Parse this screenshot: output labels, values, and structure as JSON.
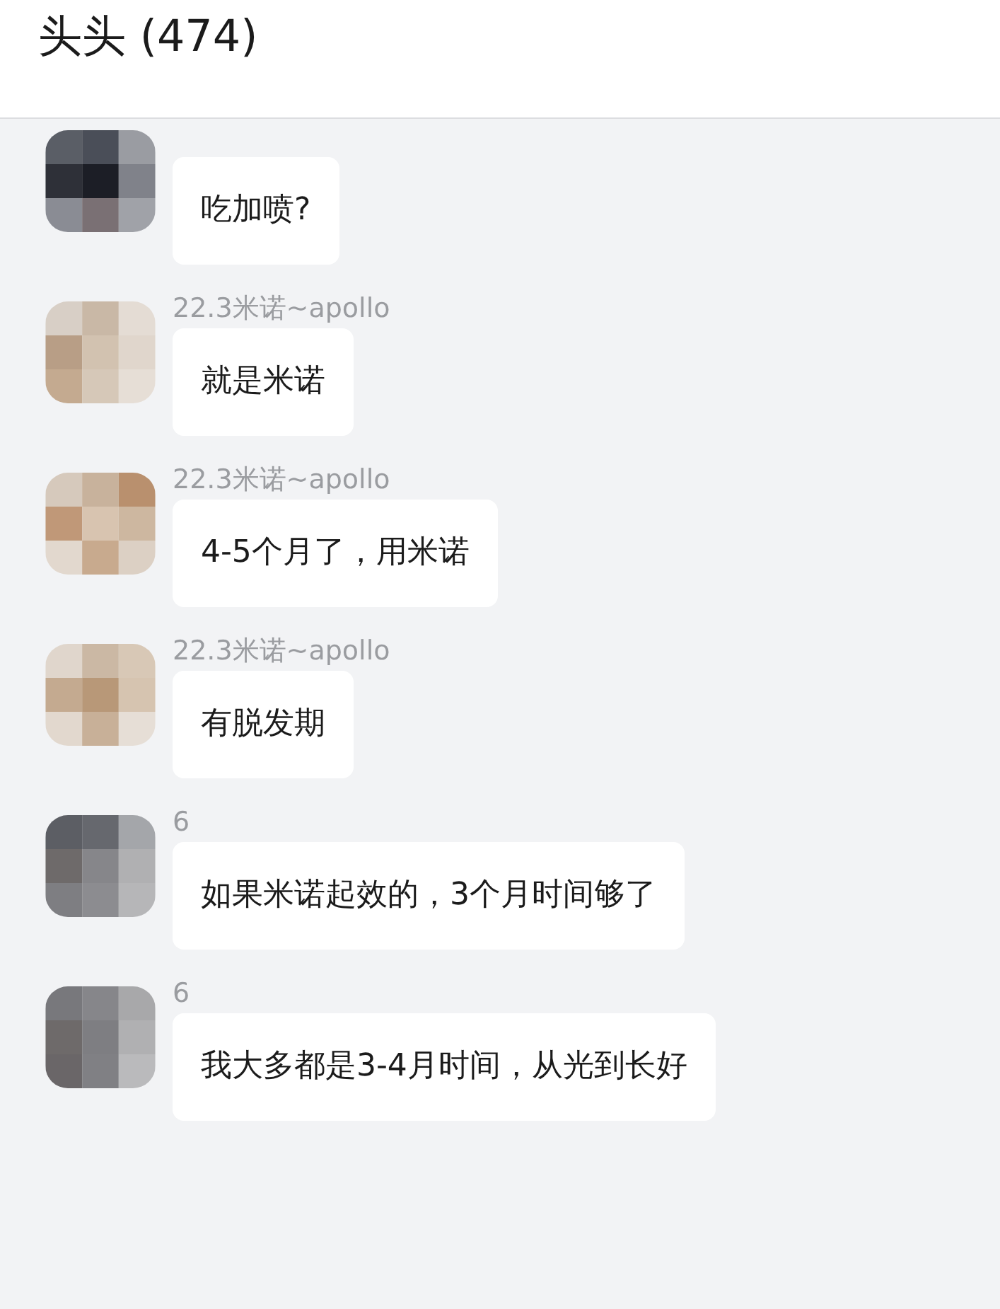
{
  "header": {
    "title": "头头 (474)"
  },
  "messages": [
    {
      "text": "吃加喷?"
    },
    {
      "sender": "22.3米诺~apollo",
      "text": "就是米诺"
    },
    {
      "sender": "22.3米诺~apollo",
      "text": "4-5个月了，用米诺"
    },
    {
      "sender": "22.3米诺~apollo",
      "text": "有脱发期"
    },
    {
      "sender": "6",
      "text": "如果米诺起效的，3个月时间够了"
    },
    {
      "sender": "6",
      "text": "我大多都是3-4月时间，从光到长好"
    }
  ]
}
